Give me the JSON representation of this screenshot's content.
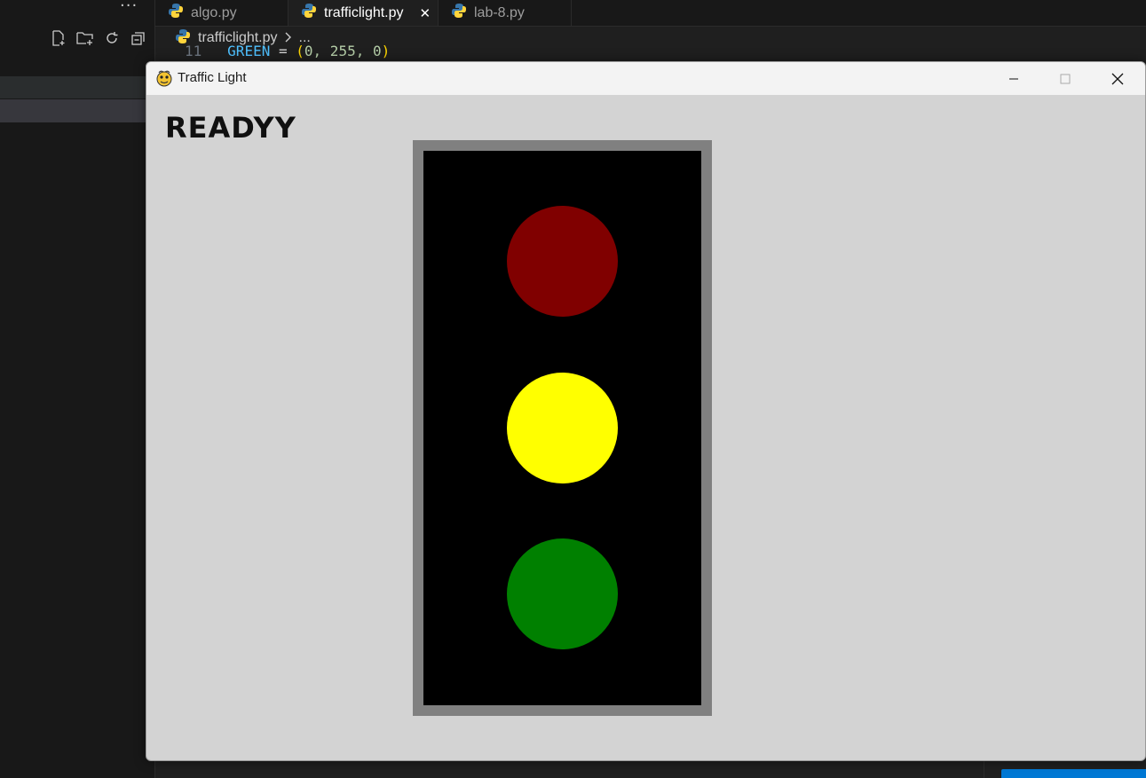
{
  "editor": {
    "more_actions": "···",
    "tabs": [
      {
        "label": "algo.py",
        "active": false
      },
      {
        "label": "trafficlight.py",
        "active": true,
        "close": "✕"
      },
      {
        "label": "lab-8.py",
        "active": false
      }
    ],
    "breadcrumb": {
      "file": "trafficlight.py",
      "rest": "..."
    },
    "code_peek": {
      "line_number": "11",
      "name": "GREEN",
      "op": "=",
      "open": "(",
      "values": "0, 255, 0",
      "close": ")"
    }
  },
  "window": {
    "title": "Traffic Light",
    "icon": "pygame-snake-icon",
    "controls": [
      "minimize-icon",
      "maximize-icon",
      "close-icon"
    ]
  },
  "game": {
    "status_text": "READYY",
    "colors": {
      "background": "#d3d3d3",
      "housing": "#808080",
      "face": "#000000",
      "red": "#800000",
      "yellow": "#ffff00",
      "green": "#008000"
    },
    "lights": [
      "red",
      "yellow",
      "green"
    ]
  }
}
